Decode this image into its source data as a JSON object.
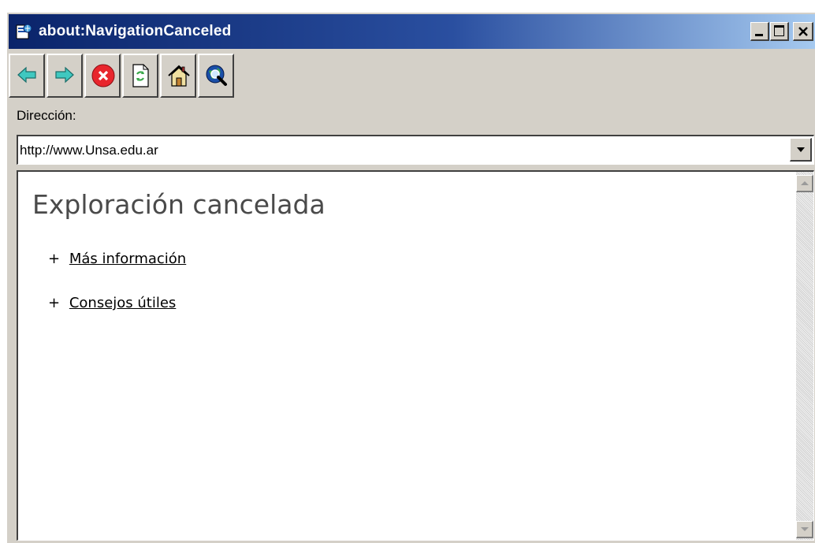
{
  "window": {
    "title": "about:NavigationCanceled",
    "icon": "browser-page-icon",
    "controls": [
      "minimize-icon",
      "maximize-icon",
      "close-icon"
    ]
  },
  "toolbar": {
    "buttons": [
      {
        "name": "back",
        "icon": "arrow-left-icon",
        "color": "#3fc8c0"
      },
      {
        "name": "forward",
        "icon": "arrow-right-icon",
        "color": "#3fc8c0"
      },
      {
        "name": "stop",
        "icon": "stop-icon",
        "color": "#e8262d"
      },
      {
        "name": "refresh",
        "icon": "refresh-icon",
        "color": "#3aa84a"
      },
      {
        "name": "home",
        "icon": "home-icon",
        "color": "#f0c030"
      },
      {
        "name": "search",
        "icon": "search-globe-icon",
        "color": "#1a4fa8"
      }
    ]
  },
  "address": {
    "label": "Dirección:",
    "value": "http://www.Unsa.edu.ar"
  },
  "page": {
    "heading": "Exploración cancelada",
    "links": [
      {
        "prefix": "+",
        "text": "Más información"
      },
      {
        "prefix": "+",
        "text": "Consejos útiles"
      }
    ]
  },
  "colors": {
    "titlebar_start": "#0a246a",
    "titlebar_end": "#a6caf0",
    "chrome": "#d4d0c8"
  }
}
